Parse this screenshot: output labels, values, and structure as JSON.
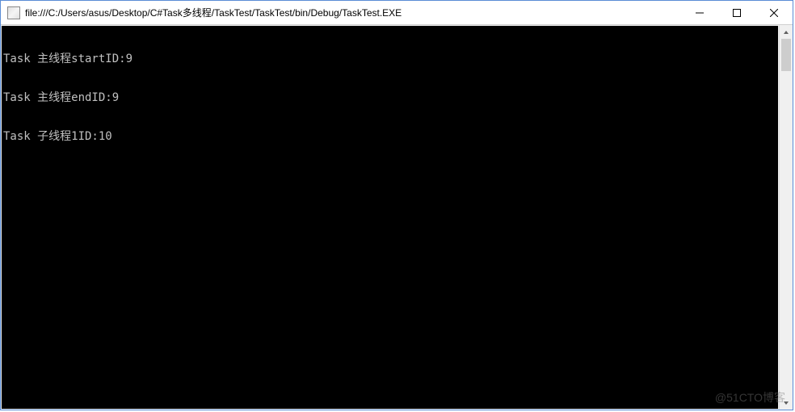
{
  "window": {
    "title": "file:///C:/Users/asus/Desktop/C#Task多线程/TaskTest/TaskTest/bin/Debug/TaskTest.EXE"
  },
  "console_lines": [
    "Task 主线程startID:9",
    "Task 主线程endID:9",
    "Task 子线程1ID:10"
  ],
  "watermark": "@51CTO博客"
}
